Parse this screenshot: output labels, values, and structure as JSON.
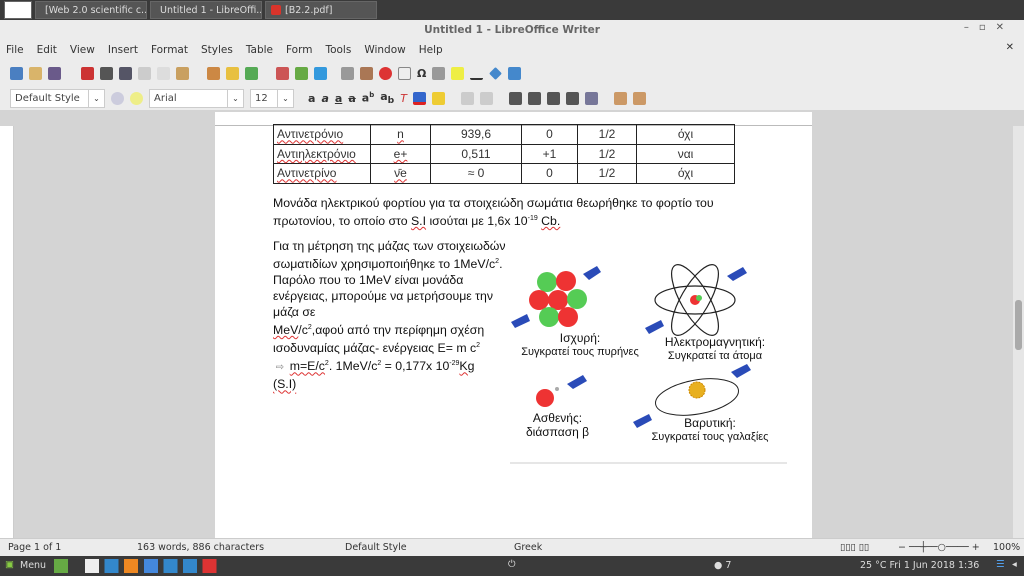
{
  "taskbar_tabs": [
    {
      "label": "[Web 2.0 scientific c...",
      "color": "#e8822a"
    },
    {
      "label": "Untitled 1 - LibreOffi...",
      "color": "#eeeeee"
    },
    {
      "label": "[B2.2.pdf]",
      "color": "#d9342b"
    }
  ],
  "window_title": "Untitled 1 - LibreOffice Writer",
  "menu": [
    "File",
    "Edit",
    "View",
    "Insert",
    "Format",
    "Styles",
    "Table",
    "Form",
    "Tools",
    "Window",
    "Help"
  ],
  "format_bar": {
    "paragraph_style": "Default Style",
    "font_name": "Arial",
    "font_size": "12"
  },
  "table": {
    "rows": [
      [
        "Αντινετρόνιο",
        "n",
        "939,6",
        "0",
        "1/2",
        "όχι"
      ],
      [
        "Αντιηλεκτρόνιο",
        "e+",
        "0,511",
        "+1",
        "1/2",
        "ναι"
      ],
      [
        "Αντινετρίνο",
        "ν̄e",
        "≈ 0",
        "0",
        "1/2",
        "όχι"
      ]
    ]
  },
  "para1": {
    "line1": "Μονάδα ηλεκτρικού φορτίου για τα στοιχειώδη σωμάτια θεωρήθηκε το φορτίο του",
    "line2a": "πρωτονίου, το οποίο στο ",
    "si": "S.I",
    "line2b": " ισούται με 1,6x 10",
    "exp": "-19",
    "unit": "Cb."
  },
  "para2": {
    "l1": "Για τη μέτρηση της μάζας των στοιχειωδών",
    "l2": "σωματιδίων χρησιμοποιήθηκε το 1MeV/c",
    "l3": "Παρόλο που το 1MeV είναι μονάδα",
    "l4": "ενέργειας, μπορούμε να μετρήσουμε την",
    "l5": "μάζα σε",
    "l6a": "MeV",
    "l6b": "/c",
    "l6c": ",αφού από την περίφημη σχέση",
    "l7": "ισοδυναμίας μάζας- ενέργειας E= m c",
    "l8a": "m=E/c",
    "l8b": ".   1MeV/c",
    "l8c": " = 0,177x 10",
    "l8exp": "-29",
    "l8unit": "Kg",
    "l9": "(S.I)",
    "sq2": "2"
  },
  "forces": [
    {
      "name": "Ισχυρή:",
      "desc": "Συγκρατεί τους πυρήνες"
    },
    {
      "name": "Ηλεκτρομαγνητική:",
      "desc": "Συγκρατεί τα άτομα"
    },
    {
      "name": "Ασθενής:",
      "desc": "διάσπαση β"
    },
    {
      "name": "Βαρυτική:",
      "desc": "Συγκρατεί τους γαλαξίες"
    }
  ],
  "status": {
    "page": "Page 1 of 1",
    "words": "163 words, 886 characters",
    "style": "Default Style",
    "language": "Greek",
    "zoom": "100%"
  },
  "taskbar": {
    "menu": "Menu",
    "clock": "25 °C Fri  1 Jun 2018  1:36",
    "num": "7"
  }
}
